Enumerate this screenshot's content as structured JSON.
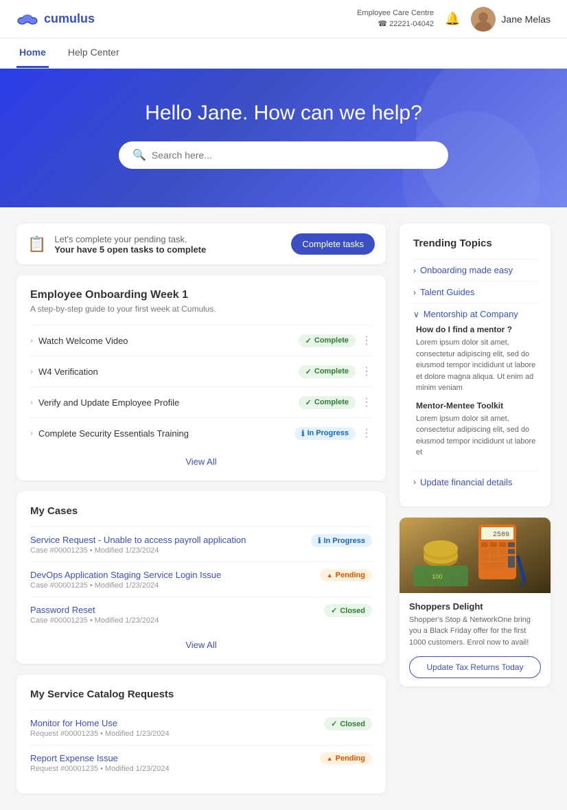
{
  "header": {
    "logo_text": "cumulus",
    "care_centre_label": "Employee Care Centre",
    "care_centre_phone": "☎ 22221-04042",
    "username": "Jane Melas"
  },
  "nav": {
    "items": [
      {
        "label": "Home",
        "active": true
      },
      {
        "label": "Help Center",
        "active": false
      }
    ]
  },
  "hero": {
    "heading": "Hello Jane. How can we help?",
    "search_placeholder": "Search here..."
  },
  "pending_banner": {
    "text": "Let's complete your pending task.",
    "strong": "Your have 5 open tasks to complete",
    "button_label": "Complete tasks"
  },
  "onboarding": {
    "title": "Employee Onboarding Week 1",
    "subtitle": "A step-by-step guide to your first week at Cumulus.",
    "tasks": [
      {
        "name": "Watch Welcome Video",
        "status": "Complete",
        "badge_type": "complete"
      },
      {
        "name": "W4 Verification",
        "status": "Complete",
        "badge_type": "complete"
      },
      {
        "name": "Verify and Update Employee Profile",
        "status": "Complete",
        "badge_type": "complete"
      },
      {
        "name": "Complete Security Essentials Training",
        "status": "In Progress",
        "badge_type": "inprogress"
      }
    ],
    "view_all_label": "View All"
  },
  "my_cases": {
    "title": "My Cases",
    "cases": [
      {
        "title": "Service Request - Unable to access payroll application",
        "meta": "Case #00001235 • Modified 1/23/2024",
        "status": "In Progress",
        "badge_type": "inprogress"
      },
      {
        "title": "DevOps Application Staging Service Login Issue",
        "meta": "Case #00001235 • Modified 1/23/2024",
        "status": "Pending",
        "badge_type": "pending"
      },
      {
        "title": "Password Reset",
        "meta": "Case #00001235 • Modified 1/23/2024",
        "status": "Closed",
        "badge_type": "closed"
      }
    ],
    "view_all_label": "View All"
  },
  "service_catalog": {
    "title": "My Service Catalog Requests",
    "items": [
      {
        "title": "Monitor for Home Use",
        "meta": "Request #00001235 • Modified 1/23/2024",
        "status": "Closed",
        "badge_type": "closed"
      },
      {
        "title": "Report Expense Issue",
        "meta": "Request #00001235 • Modified 1/23/2024",
        "status": "Pending",
        "badge_type": "pending"
      }
    ]
  },
  "trending": {
    "title": "Trending Topics",
    "topics": [
      {
        "label": "Onboarding made easy",
        "expanded": false
      },
      {
        "label": "Talent Guides",
        "expanded": false
      },
      {
        "label": "Mentorship at Company",
        "expanded": true,
        "sub_sections": [
          {
            "title": "How do I find a mentor ?",
            "text": "Lorem ipsum dolor sit amet, consectetur adipiscing elit, sed do eiusmod tempor incididunt ut labore et dolore magna aliqua. Ut enim ad minim veniam"
          },
          {
            "title": "Mentor-Mentee Toolkit",
            "text": "Lorem ipsum dolor sit amet, consectetur adipiscing elit, sed do eiusmod tempor incididunt ut labore et"
          }
        ]
      },
      {
        "label": "Update financial details",
        "expanded": false
      }
    ]
  },
  "promo": {
    "brand": "Shoppers Delight",
    "description": "Shopper's Stop & NetworkOne bring you a Black Friday offer for the first 1000 customers. Enrol now to avail!",
    "button_label": "Update Tax Returns Today"
  }
}
